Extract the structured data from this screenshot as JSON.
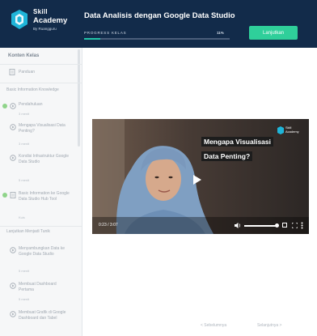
{
  "brand": {
    "line1": "Skill",
    "line2": "Academy",
    "line3": "By Ruangguru"
  },
  "header": {
    "course_title": "Data Analisis dengan Google Data Studio",
    "progress_label": "PROGRESS KELAS",
    "progress_pct_text": "11%",
    "progress_value": 0.11,
    "cta_label": "Lanjutkan",
    "accent_color": "#2fcf9a",
    "bg_color": "#122b4a"
  },
  "sidebar": {
    "heading": "Konten Kelas",
    "intro_item": "Panduan",
    "section1": "Basic Information Knowledge",
    "items": [
      {
        "label": "Pendahuluan",
        "sub": "3 menit",
        "done": true,
        "icon": "play-circle-icon"
      },
      {
        "label": "Mengapa Visualisasi Data Penting?",
        "sub": "3 menit",
        "done": false,
        "icon": "play-circle-icon"
      },
      {
        "label": "Kondisi Infrastruktur Google Data Studio",
        "sub": "5 menit",
        "done": false,
        "icon": "play-circle-icon"
      },
      {
        "label": "Basic Information ke Google Data Studio Hub Tool",
        "sub": "Kuis",
        "done": true,
        "icon": "document-icon"
      }
    ],
    "section2": "Lanjutkan Menjadi Tunik",
    "items2": [
      {
        "label": "Menyambungkan Data ke Google Data Studio",
        "sub": "5 menit",
        "icon": "play-circle-icon"
      },
      {
        "label": "Membuat Dashboard Pertama",
        "sub": "5 menit",
        "icon": "play-circle-icon"
      },
      {
        "label": "Membuat Grafik di Google Dashboard dan Tabel",
        "sub": "5 menit",
        "icon": "play-circle-icon"
      }
    ]
  },
  "video": {
    "title_line1": "Mengapa Visualisasi",
    "title_line2": "Data Penting?",
    "badge_line1": "Skill",
    "badge_line2": "Academy",
    "time": "0:23 / 3:07",
    "volume_level": 0.9
  },
  "footer_nav": {
    "prev": "< Sebelumnya",
    "next": "Selanjutnya >"
  }
}
